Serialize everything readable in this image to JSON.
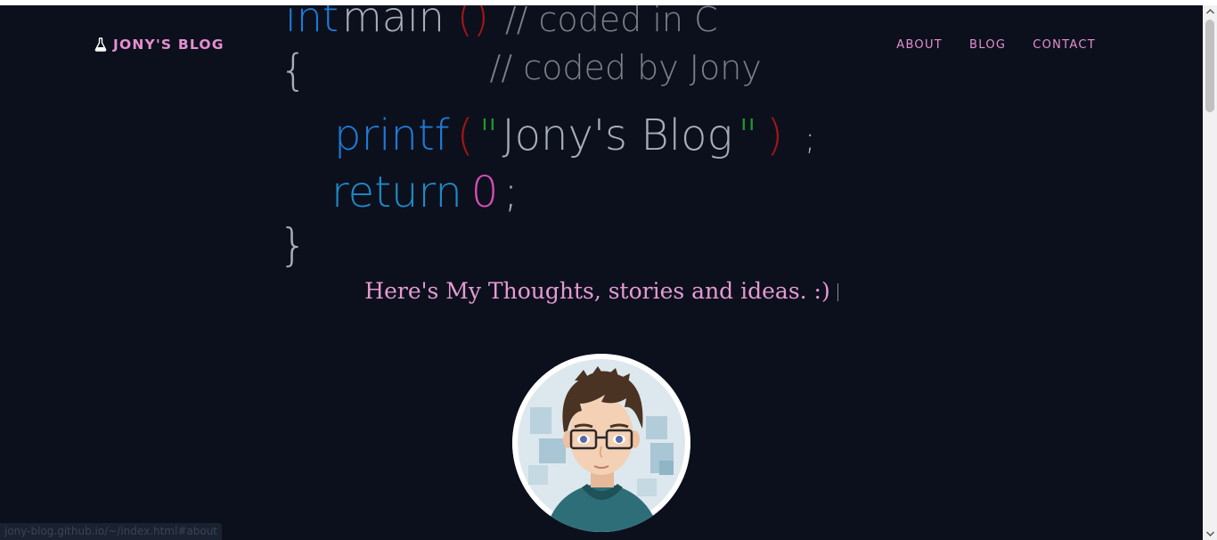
{
  "brand": {
    "name": "JONY'S BLOG",
    "icon": "flask-icon",
    "color": "#e58fd0"
  },
  "nav": {
    "items": [
      {
        "label": "ABOUT"
      },
      {
        "label": "BLOG"
      },
      {
        "label": "CONTACT"
      }
    ]
  },
  "hero_code": {
    "line1_kw": "int",
    "line1_fn": "main",
    "line1_paren": "()",
    "line1_comment": "// coded in C",
    "line2_brace": "{",
    "line2_comment": "// coded by Jony",
    "line3_fn": "printf",
    "line3_open": "(",
    "line3_q1": "\"",
    "line3_str": "Jony's Blog",
    "line3_q2": "\"",
    "line3_close": ")",
    "line3_semi": ";",
    "line4_kw": "return",
    "line4_num": "0",
    "line4_semi": ";",
    "line5_brace": "}"
  },
  "tagline": "Here's My Thoughts, stories and ideas. :)",
  "status_url": "jony-blog.github.io/~/index.html#about",
  "colors": {
    "background": "#0c101d",
    "accent": "#e58fd0"
  }
}
